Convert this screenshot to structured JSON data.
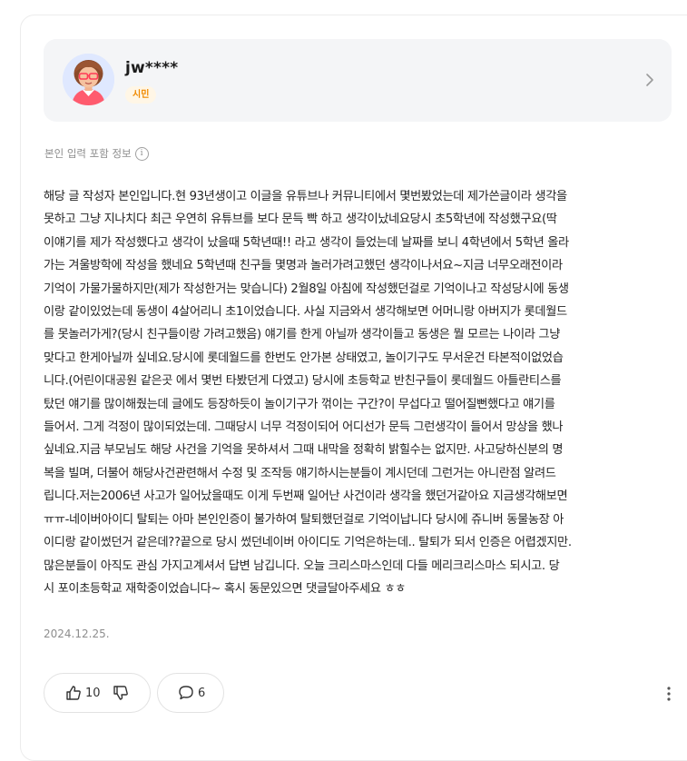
{
  "author": {
    "username": "jw****",
    "grade": "시민"
  },
  "info_label": "본인 입력 포함 정보",
  "post": {
    "lines": [
      "해당 글 작성자 본인입니다.현 93년생이고 이글을 유튜브나 커뮤니티에서 몇번봤었는데 제가쓴글이라 생각을",
      "못하고 그냥 지나치다 최근 우연히 유튜브를 보다 문득 빡 하고 생각이났네요당시 초5학년에 작성했구요(딱",
      "이얘기를 제가 작성했다고 생각이 났을때 5학년때!! 라고 생각이 들었는데 날짜를 보니 4학년에서 5학년 올라",
      "가는 겨울방학에 작성을 했네요 5학년때 친구들 몇명과 놀러가려고했던 생각이나서요~지금 너무오래전이라",
      "기억이 가물가물하지만(제가 작성한거는 맞습니다) 2월8일 아침에 작성했던걸로 기억이나고 작성당시에 동생",
      "이랑 같이있었는데 동생이 4살어리니 초1이었습니다. 사실 지금와서 생각해보면 어머니랑 아버지가 롯데월드",
      "를 못놀러가게?(당시 친구들이랑 가려고했음) 얘기를 한게 아닐까 생각이들고 동생은 뭘 모르는 나이라 그냥",
      "맞다고 한게아닐까 싶네요.당시에 롯데월드를 한번도 안가본 상태였고, 놀이기구도 무서운건 타본적이없었습",
      "니다.(어린이대공원 같은곳 에서 몇번 타봤던게 다였고) 당시에 초등학교 반친구들이 롯데월드 아틀란티스를",
      "탔던 얘기를 많이해줬는데 글에도 등장하듯이 놀이기구가 꺾이는 구간?이 무섭다고 떨어질뻔했다고 얘기를",
      "들어서. 그게 걱정이 많이되었는데. 그때당시 너무 걱정이되어 어디선가 문득 그런생각이 들어서 망상을 했나",
      "싶네요.지금 부모님도 해당 사건을 기억을 못하셔서 그때 내막을 정확히 밝힐수는 없지만. 사고당하신분의 명",
      "복을 빌며, 더불어 해당사건관련해서 수정 및 조작등 얘기하시는분들이 계시던데 그런거는 아니란점 알려드",
      "립니다.저는2006년 사고가 일어났을때도 이게 두번째 일어난 사건이라 생각을 했던거같아요 지금생각해보면",
      "ㅠㅠ-네이버아이디 탈퇴는 아마 본인인증이 불가하여 탈퇴했던걸로 기억이납니다 당시에 쥬니버 동물농장 아",
      "이디랑 같이썼던거 같은데??끝으로 당시 썼던네이버 아이디도 기억은하는데.. 탈퇴가 되서 인증은 어렵겠지만.",
      "많은분들이 아직도 관심 가지고계셔서 답변 남깁니다. 오늘 크리스마스인데 다들 메리크리스마스 되시고. 당",
      "시 포이초등학교 재학중이었습니다~ 혹시 동문있으면 댓글달아주세요 ㅎㅎ"
    ],
    "date": "2024.12.25."
  },
  "reactions": {
    "like_count": "10",
    "comment_count": "6"
  },
  "icons": {
    "chevron": "chevron-right-icon",
    "info": "info-icon",
    "like": "thumbs-up-icon",
    "dislike": "thumbs-down-icon",
    "comment": "speech-bubble-icon",
    "more": "more-vertical-icon"
  },
  "colors": {
    "badge_text": "#f08a00",
    "badge_bg": "#fff6e6",
    "card_bg": "#f4f5f7"
  }
}
